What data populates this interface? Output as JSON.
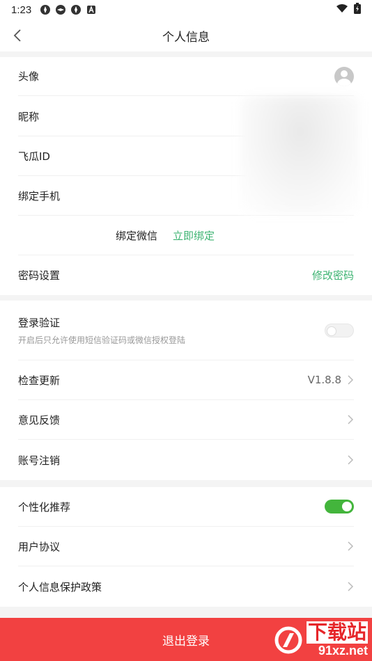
{
  "status_bar": {
    "time": "1:23"
  },
  "nav": {
    "title": "个人信息"
  },
  "profile": {
    "avatar_label": "头像",
    "nickname_label": "昵称",
    "id_label": "飞瓜ID",
    "phone_label": "绑定手机",
    "wechat_label": "绑定微信",
    "wechat_action": "立即绑定",
    "password_label": "密码设置",
    "password_action": "修改密码"
  },
  "security": {
    "login_verify_label": "登录验证",
    "login_verify_desc": "开启后只允许使用短信验证码或微信授权登陆",
    "login_verify_on": false,
    "update_label": "检查更新",
    "version": "V1.8.8",
    "feedback_label": "意见反馈",
    "cancel_account_label": "账号注销"
  },
  "privacy": {
    "recommend_label": "个性化推荐",
    "recommend_on": true,
    "agreement_label": "用户协议",
    "policy_label": "个人信息保护政策"
  },
  "logout_label": "退出登录",
  "watermark": {
    "cn": "下载站",
    "en": "91xz.net"
  },
  "colors": {
    "accent_green": "#3cb371",
    "toggle_on": "#43b53c",
    "logout_red": "#f24141"
  }
}
